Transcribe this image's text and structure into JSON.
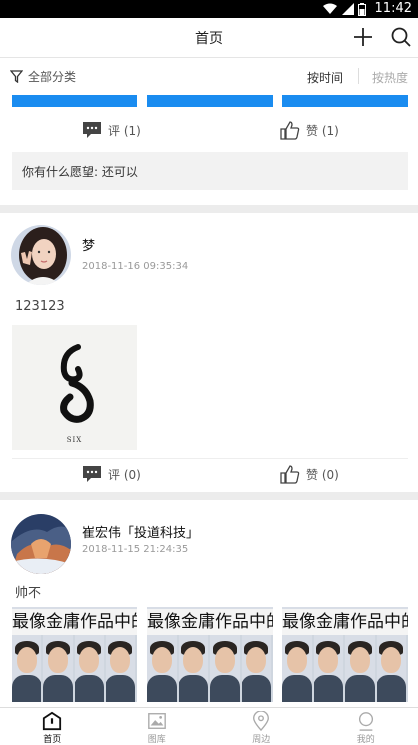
{
  "status_bar": {
    "time": "11:42"
  },
  "header": {
    "title": "首页"
  },
  "filter_bar": {
    "all_categories": "全部分类",
    "sort_by_time": "按时间",
    "sort_by_hot": "按热度"
  },
  "first_card": {
    "comment_label": "评 (1)",
    "like_label": "赞 (1)",
    "wish_text": "你有什么愿望: 还可以"
  },
  "posts": [
    {
      "username": "梦",
      "timestamp": "2018-11-16 09:35:34",
      "text": "123123",
      "image_caption": "SIX",
      "comment_label": "评 (0)",
      "like_label": "赞 (0)"
    },
    {
      "username": "崔宏伟「投道科技」",
      "timestamp": "2018-11-15 21:24:35",
      "text": "帅不",
      "photo_title": "最像金庸作品中的"
    }
  ],
  "bottom_nav": [
    {
      "label": "首页",
      "icon": "home-icon",
      "active": true
    },
    {
      "label": "图库",
      "icon": "gallery-icon",
      "active": false
    },
    {
      "label": "周边",
      "icon": "location-icon",
      "active": false
    },
    {
      "label": "我的",
      "icon": "profile-icon",
      "active": false
    }
  ],
  "colors": {
    "accent_blue": "#1a8cf0",
    "divider": "#ececec"
  }
}
